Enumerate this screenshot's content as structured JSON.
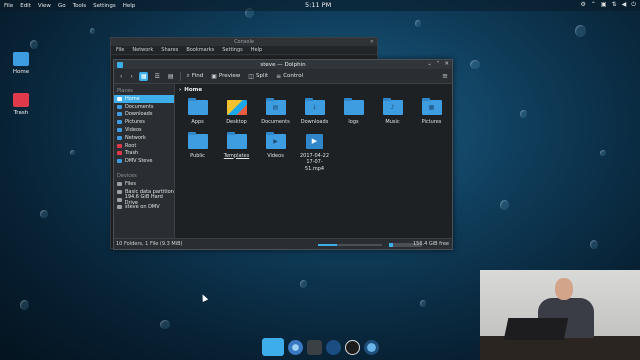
{
  "top_panel": {
    "menu": [
      "File",
      "Edit",
      "View",
      "Go",
      "Tools",
      "Settings",
      "Help"
    ],
    "clock": "5:11 PM",
    "tray_icons": [
      "settings-icon",
      "chevron-icon",
      "clipboard-icon",
      "network-icon",
      "volume-icon",
      "power-icon"
    ]
  },
  "desktop": {
    "icons": [
      {
        "name": "home",
        "label": "Home",
        "color": "#3d9de0"
      },
      {
        "name": "trash",
        "label": "Trash",
        "color": "#e0394b"
      }
    ]
  },
  "console": {
    "title": "Console",
    "menu": [
      "File",
      "Network",
      "Shares",
      "Bookmarks",
      "Settings",
      "Help"
    ]
  },
  "dolphin": {
    "title": "steve — Dolphin",
    "toolbar": {
      "find": "Find",
      "preview": "Preview",
      "split": "Split",
      "control": "Control"
    },
    "places": {
      "header": "Places",
      "items": [
        "Home",
        "Documents",
        "Downloads",
        "Pictures",
        "Videos",
        "Network",
        "Root",
        "Trash",
        "DMV Steve"
      ],
      "devices_header": "Devices",
      "devices": [
        "Files",
        "Basic data partition",
        "194.6 GiB Hard Drive",
        "steve on DMV"
      ]
    },
    "breadcrumb": "Home",
    "files": [
      {
        "label": "Apps",
        "kind": "folder",
        "emblem": ""
      },
      {
        "label": "Desktop",
        "kind": "desktop",
        "emblem": ""
      },
      {
        "label": "Documents",
        "kind": "folder",
        "emblem": "▤"
      },
      {
        "label": "Downloads",
        "kind": "folder",
        "emblem": "↓"
      },
      {
        "label": "logs",
        "kind": "folder",
        "emblem": ""
      },
      {
        "label": "Music",
        "kind": "folder",
        "emblem": "♪"
      },
      {
        "label": "Pictures",
        "kind": "folder",
        "emblem": "▦"
      },
      {
        "label": "Public",
        "kind": "folder",
        "emblem": ""
      },
      {
        "label": "Templates",
        "kind": "folder",
        "emblem": ""
      },
      {
        "label": "Videos",
        "kind": "folder",
        "emblem": "▶"
      },
      {
        "label": "2017-04-22 17-07-51.mp4",
        "kind": "video",
        "emblem": "▶"
      }
    ],
    "status": {
      "text": "10 Folders, 1 File (9.3 MiB)",
      "zoom_fraction": 0.3,
      "used_fraction": 0.12,
      "free": "156.4 GiB free"
    }
  },
  "dock": {
    "apps": [
      "dolphin-app",
      "chromium-app",
      "terminal-app",
      "steam-app",
      "obs-app",
      "network-app"
    ]
  },
  "colors": {
    "accent": "#3daee9",
    "window_bg": "#2a2e32",
    "content_bg": "#1e2124"
  }
}
